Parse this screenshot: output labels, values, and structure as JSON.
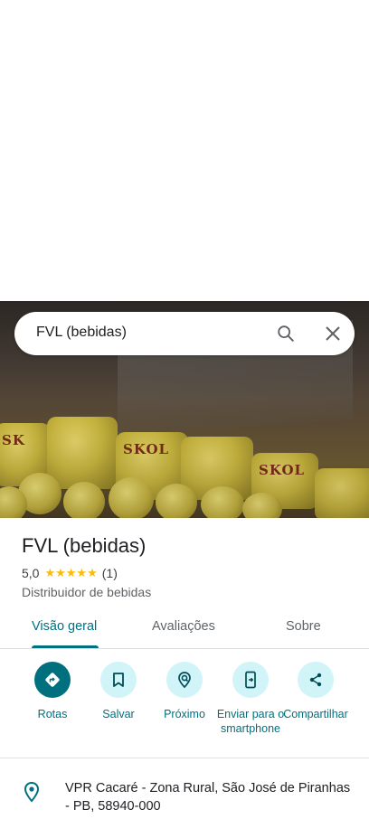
{
  "search": {
    "query": "FVL (bebidas)"
  },
  "place": {
    "name": "FVL (bebidas)",
    "rating": "5,0",
    "stars": "★★★★★",
    "rating_value": 5.0,
    "review_count": "(1)",
    "category": "Distribuidor de bebidas"
  },
  "tabs": [
    {
      "label": "Visão geral",
      "active": true
    },
    {
      "label": "Avaliações",
      "active": false
    },
    {
      "label": "Sobre",
      "active": false
    }
  ],
  "actions": [
    {
      "label": "Rotas",
      "icon": "directions-icon"
    },
    {
      "label": "Salvar",
      "icon": "bookmark-icon"
    },
    {
      "label": "Próximo",
      "icon": "nearby-icon"
    },
    {
      "label": "Enviar para o smartphone",
      "icon": "send-to-phone-icon"
    },
    {
      "label": "Compartilhar",
      "icon": "share-icon"
    }
  ],
  "address": {
    "text": "VPR Cacaré - Zona Rural, São José de Piranhas - PB, 58940-000",
    "icon": "location-pin-icon"
  },
  "colors": {
    "accent": "#00707e",
    "accent_light": "#d0f4f8",
    "star": "#fbbc04"
  }
}
